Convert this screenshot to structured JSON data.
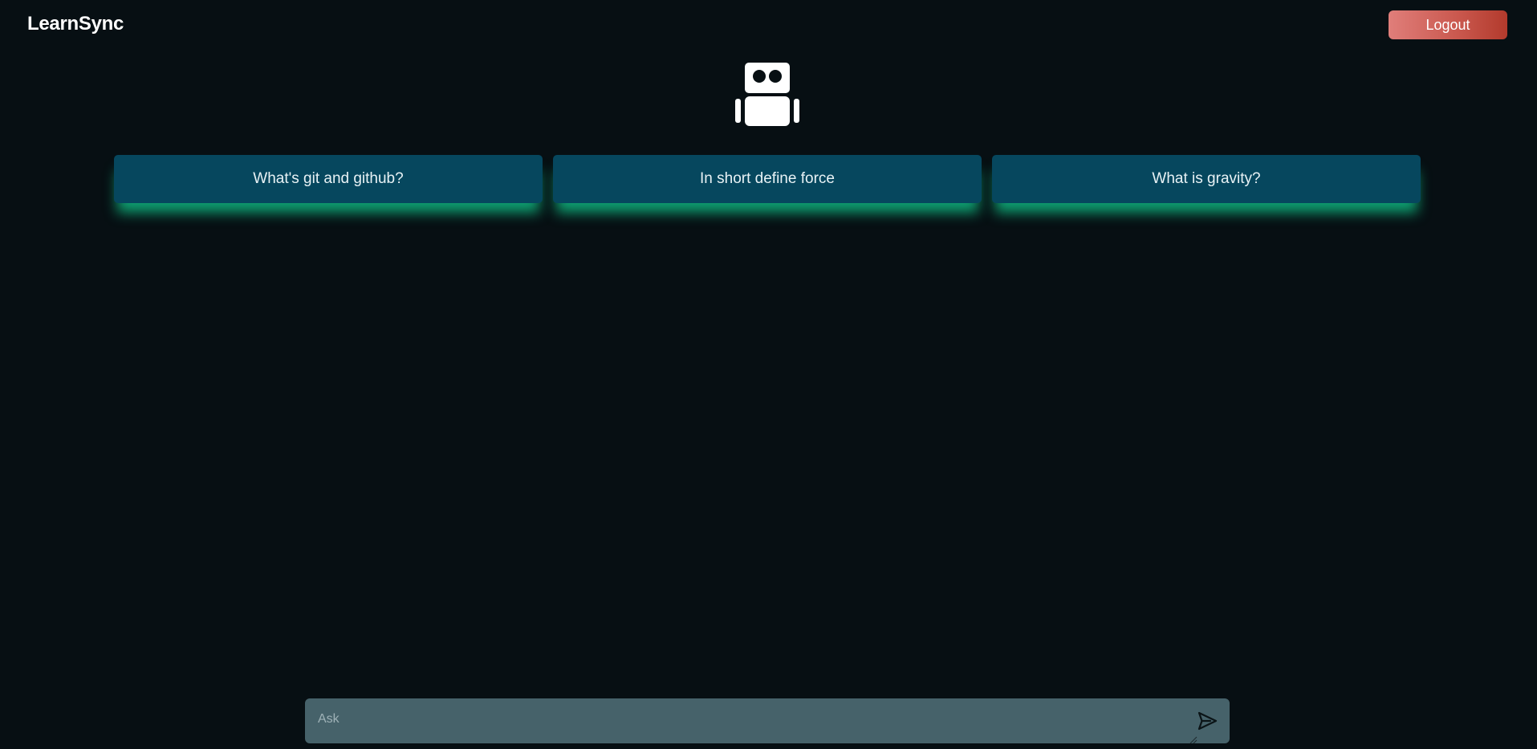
{
  "header": {
    "brand": "LearnSync",
    "logout_label": "Logout"
  },
  "hero": {
    "icon": "robot-icon"
  },
  "suggestions": [
    {
      "label": "What's git and github?"
    },
    {
      "label": "In short define force"
    },
    {
      "label": "What is gravity?"
    }
  ],
  "ask": {
    "placeholder": "Ask",
    "value": "",
    "send_icon": "send-icon"
  },
  "colors": {
    "background": "#070f13",
    "suggestion_bg": "#06475e",
    "suggestion_glow": "#10b981",
    "logout_gradient_start": "#e07e7a",
    "logout_gradient_end": "#b23a2c",
    "ask_bar_bg": "#46626a"
  }
}
